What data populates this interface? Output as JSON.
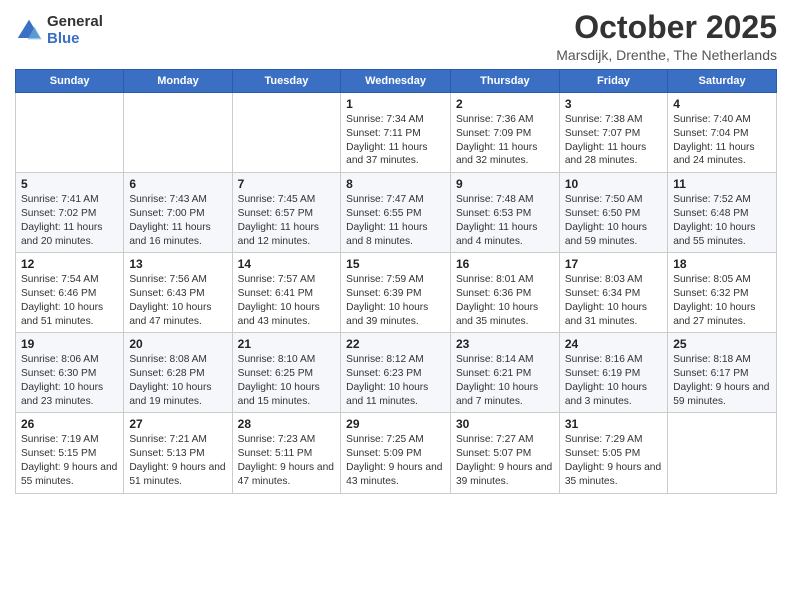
{
  "logo": {
    "general": "General",
    "blue": "Blue"
  },
  "title": "October 2025",
  "location": "Marsdijk, Drenthe, The Netherlands",
  "days_of_week": [
    "Sunday",
    "Monday",
    "Tuesday",
    "Wednesday",
    "Thursday",
    "Friday",
    "Saturday"
  ],
  "weeks": [
    [
      {
        "day": "",
        "info": ""
      },
      {
        "day": "",
        "info": ""
      },
      {
        "day": "",
        "info": ""
      },
      {
        "day": "1",
        "info": "Sunrise: 7:34 AM\nSunset: 7:11 PM\nDaylight: 11 hours and 37 minutes."
      },
      {
        "day": "2",
        "info": "Sunrise: 7:36 AM\nSunset: 7:09 PM\nDaylight: 11 hours and 32 minutes."
      },
      {
        "day": "3",
        "info": "Sunrise: 7:38 AM\nSunset: 7:07 PM\nDaylight: 11 hours and 28 minutes."
      },
      {
        "day": "4",
        "info": "Sunrise: 7:40 AM\nSunset: 7:04 PM\nDaylight: 11 hours and 24 minutes."
      }
    ],
    [
      {
        "day": "5",
        "info": "Sunrise: 7:41 AM\nSunset: 7:02 PM\nDaylight: 11 hours and 20 minutes."
      },
      {
        "day": "6",
        "info": "Sunrise: 7:43 AM\nSunset: 7:00 PM\nDaylight: 11 hours and 16 minutes."
      },
      {
        "day": "7",
        "info": "Sunrise: 7:45 AM\nSunset: 6:57 PM\nDaylight: 11 hours and 12 minutes."
      },
      {
        "day": "8",
        "info": "Sunrise: 7:47 AM\nSunset: 6:55 PM\nDaylight: 11 hours and 8 minutes."
      },
      {
        "day": "9",
        "info": "Sunrise: 7:48 AM\nSunset: 6:53 PM\nDaylight: 11 hours and 4 minutes."
      },
      {
        "day": "10",
        "info": "Sunrise: 7:50 AM\nSunset: 6:50 PM\nDaylight: 10 hours and 59 minutes."
      },
      {
        "day": "11",
        "info": "Sunrise: 7:52 AM\nSunset: 6:48 PM\nDaylight: 10 hours and 55 minutes."
      }
    ],
    [
      {
        "day": "12",
        "info": "Sunrise: 7:54 AM\nSunset: 6:46 PM\nDaylight: 10 hours and 51 minutes."
      },
      {
        "day": "13",
        "info": "Sunrise: 7:56 AM\nSunset: 6:43 PM\nDaylight: 10 hours and 47 minutes."
      },
      {
        "day": "14",
        "info": "Sunrise: 7:57 AM\nSunset: 6:41 PM\nDaylight: 10 hours and 43 minutes."
      },
      {
        "day": "15",
        "info": "Sunrise: 7:59 AM\nSunset: 6:39 PM\nDaylight: 10 hours and 39 minutes."
      },
      {
        "day": "16",
        "info": "Sunrise: 8:01 AM\nSunset: 6:36 PM\nDaylight: 10 hours and 35 minutes."
      },
      {
        "day": "17",
        "info": "Sunrise: 8:03 AM\nSunset: 6:34 PM\nDaylight: 10 hours and 31 minutes."
      },
      {
        "day": "18",
        "info": "Sunrise: 8:05 AM\nSunset: 6:32 PM\nDaylight: 10 hours and 27 minutes."
      }
    ],
    [
      {
        "day": "19",
        "info": "Sunrise: 8:06 AM\nSunset: 6:30 PM\nDaylight: 10 hours and 23 minutes."
      },
      {
        "day": "20",
        "info": "Sunrise: 8:08 AM\nSunset: 6:28 PM\nDaylight: 10 hours and 19 minutes."
      },
      {
        "day": "21",
        "info": "Sunrise: 8:10 AM\nSunset: 6:25 PM\nDaylight: 10 hours and 15 minutes."
      },
      {
        "day": "22",
        "info": "Sunrise: 8:12 AM\nSunset: 6:23 PM\nDaylight: 10 hours and 11 minutes."
      },
      {
        "day": "23",
        "info": "Sunrise: 8:14 AM\nSunset: 6:21 PM\nDaylight: 10 hours and 7 minutes."
      },
      {
        "day": "24",
        "info": "Sunrise: 8:16 AM\nSunset: 6:19 PM\nDaylight: 10 hours and 3 minutes."
      },
      {
        "day": "25",
        "info": "Sunrise: 8:18 AM\nSunset: 6:17 PM\nDaylight: 9 hours and 59 minutes."
      }
    ],
    [
      {
        "day": "26",
        "info": "Sunrise: 7:19 AM\nSunset: 5:15 PM\nDaylight: 9 hours and 55 minutes."
      },
      {
        "day": "27",
        "info": "Sunrise: 7:21 AM\nSunset: 5:13 PM\nDaylight: 9 hours and 51 minutes."
      },
      {
        "day": "28",
        "info": "Sunrise: 7:23 AM\nSunset: 5:11 PM\nDaylight: 9 hours and 47 minutes."
      },
      {
        "day": "29",
        "info": "Sunrise: 7:25 AM\nSunset: 5:09 PM\nDaylight: 9 hours and 43 minutes."
      },
      {
        "day": "30",
        "info": "Sunrise: 7:27 AM\nSunset: 5:07 PM\nDaylight: 9 hours and 39 minutes."
      },
      {
        "day": "31",
        "info": "Sunrise: 7:29 AM\nSunset: 5:05 PM\nDaylight: 9 hours and 35 minutes."
      },
      {
        "day": "",
        "info": ""
      }
    ]
  ]
}
